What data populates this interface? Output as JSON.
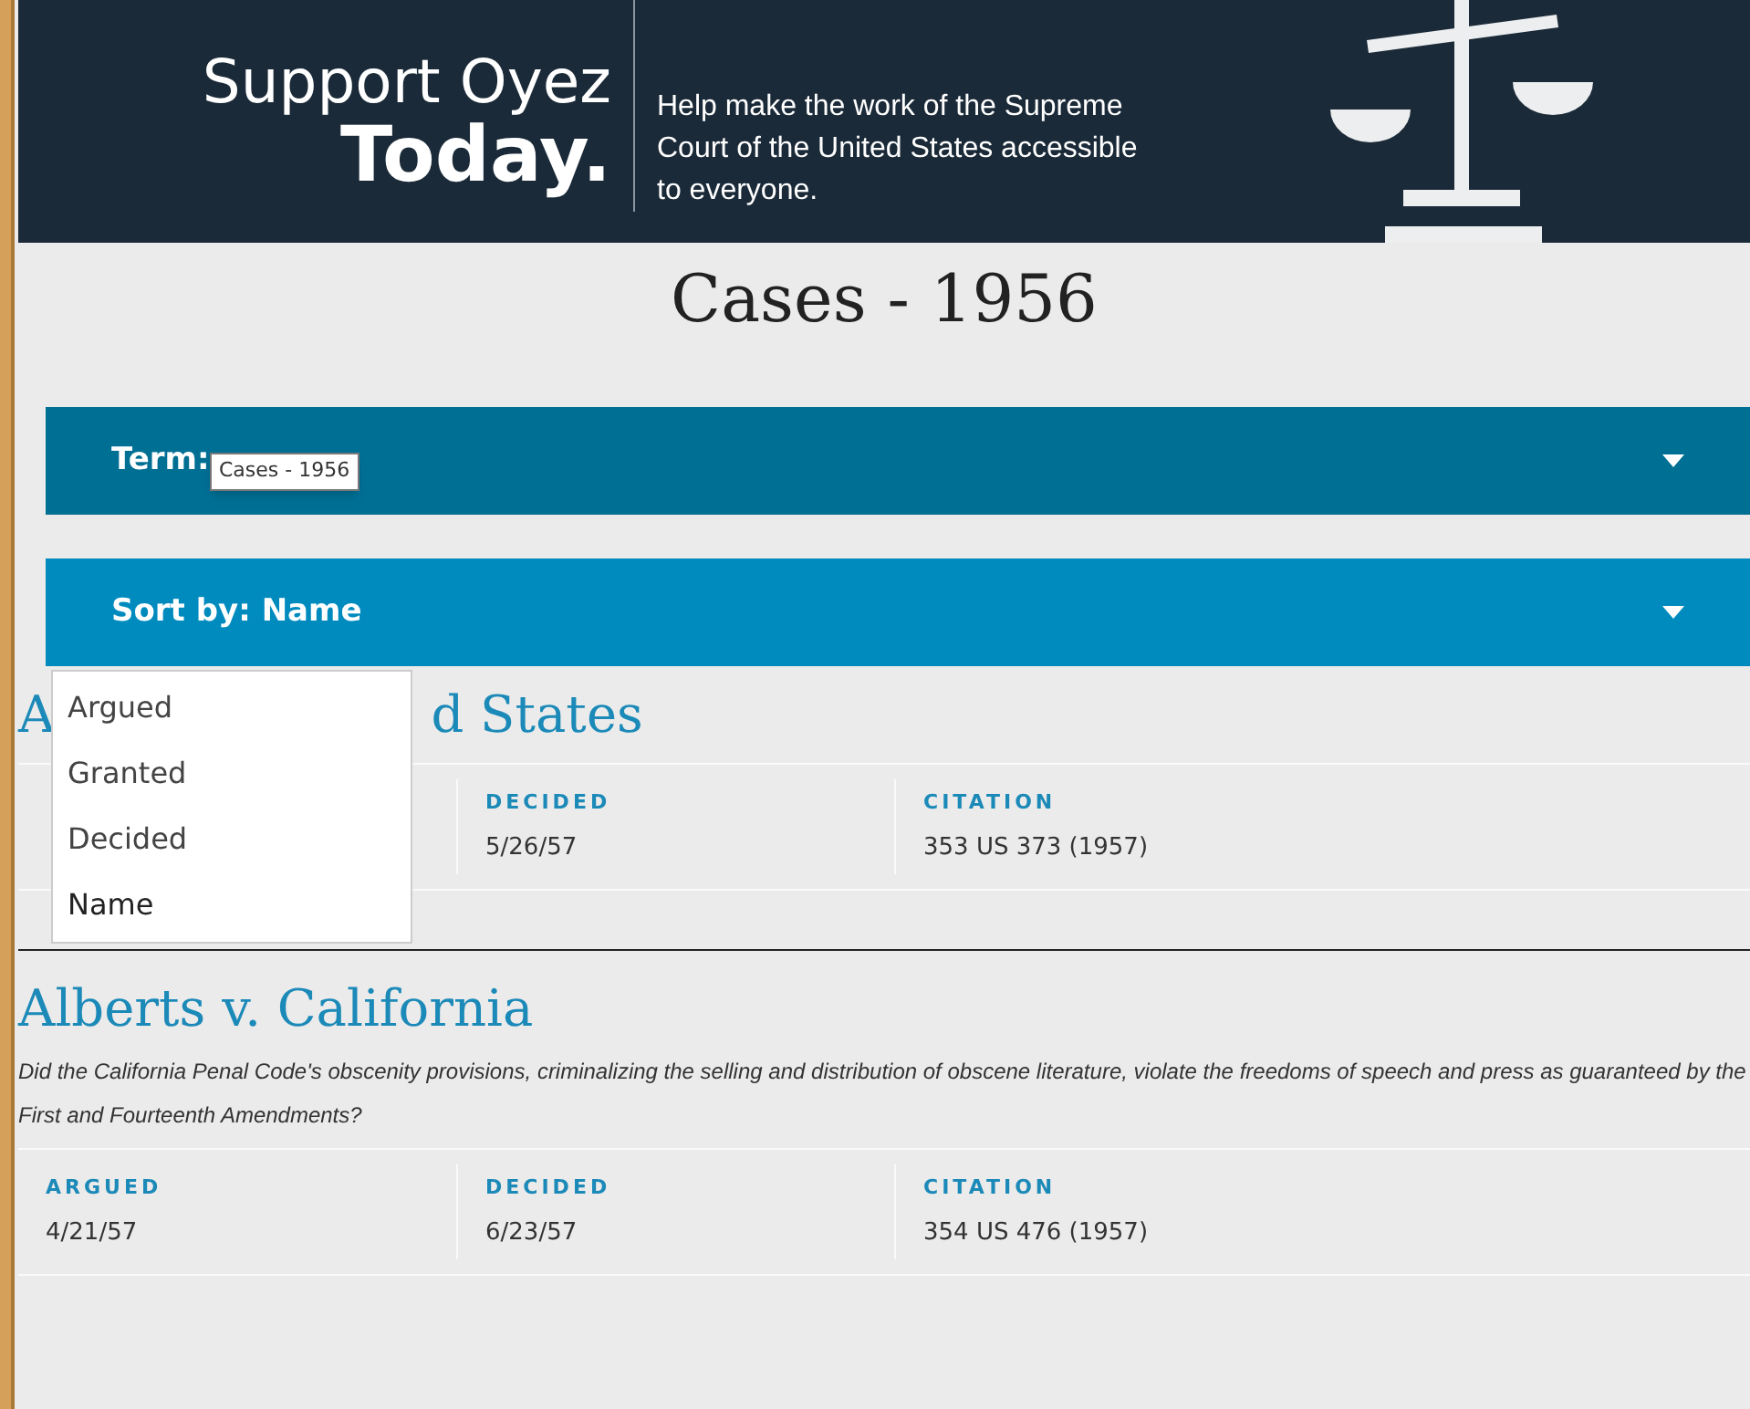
{
  "banner": {
    "title_line_1": "Support Oyez",
    "title_line_2": "Today.",
    "message": "Help make the work of the Supreme Court of the United States accessible to everyone."
  },
  "heading": "Cases - 1956",
  "filters": [
    {
      "label": "Term:",
      "tooltip": "Cases - 1956"
    },
    {
      "label": "Sort by: Name",
      "expanded": true,
      "options": [
        {
          "label": "Argued",
          "selected": false
        },
        {
          "label": "Granted",
          "selected": false
        },
        {
          "label": "Decided",
          "selected": false
        },
        {
          "label": "Name",
          "selected": true
        }
      ]
    }
  ],
  "cases": [
    {
      "title_fragments": [
        "A",
        "d States"
      ],
      "facts": [
        {
          "label": "DECIDED",
          "value": "5/26/57"
        },
        {
          "label": "CITATION",
          "value": "353 US 373 (1957)"
        }
      ]
    },
    {
      "title_fragments": [
        "Alberts v. California"
      ],
      "question": "Did the California Penal Code's obscenity provisions, criminalizing the selling and distribution of obscene literature, violate the freedoms of speech and press as guaranteed by the First and Fourteenth Amendments?",
      "facts": [
        {
          "label": "ARGUED",
          "value": "4/21/57"
        },
        {
          "label": "DECIDED",
          "value": "6/23/57"
        },
        {
          "label": "CITATION",
          "value": "354 US 476 (1957)"
        }
      ]
    }
  ]
}
